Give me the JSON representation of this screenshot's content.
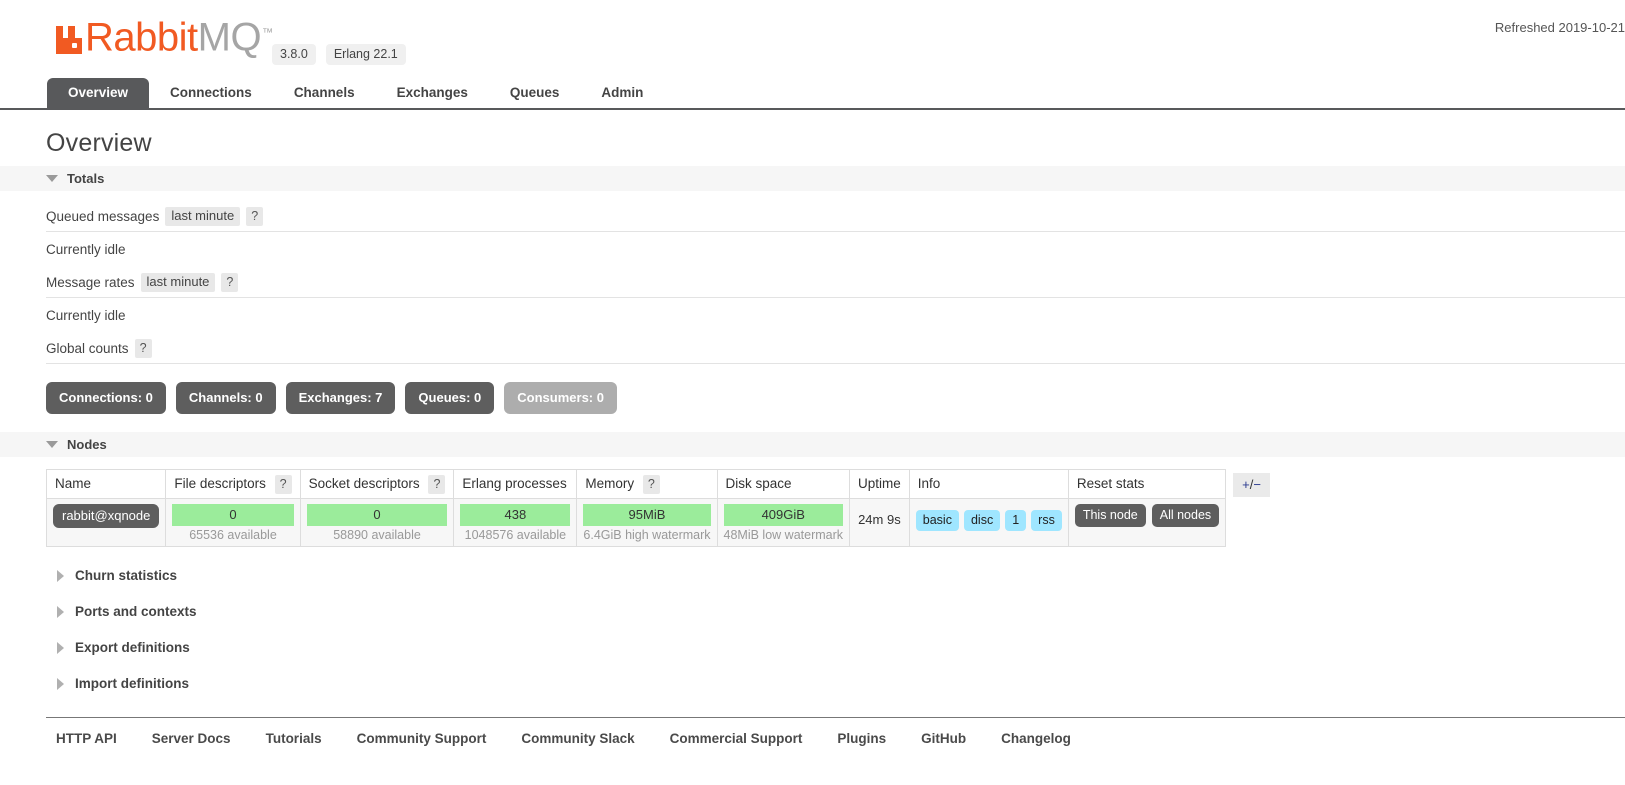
{
  "header": {
    "logo_rabbit": "Rabbit",
    "logo_mq": "MQ",
    "logo_tm": "™",
    "version": "3.8.0",
    "erlang": "Erlang 22.1",
    "refreshed": "Refreshed 2019-10-21"
  },
  "nav": {
    "tabs": [
      {
        "label": "Overview",
        "active": true
      },
      {
        "label": "Connections",
        "active": false
      },
      {
        "label": "Channels",
        "active": false
      },
      {
        "label": "Exchanges",
        "active": false
      },
      {
        "label": "Queues",
        "active": false
      },
      {
        "label": "Admin",
        "active": false
      }
    ]
  },
  "page": {
    "title": "Overview"
  },
  "totals": {
    "section_label": "Totals",
    "queued_messages_label": "Queued messages",
    "queued_messages_period": "last minute",
    "help": "?",
    "queued_messages_status": "Currently idle",
    "message_rates_label": "Message rates",
    "message_rates_period": "last minute",
    "message_rates_status": "Currently idle",
    "global_counts_label": "Global counts",
    "counts": [
      {
        "label": "Connections: 0",
        "muted": false
      },
      {
        "label": "Channels: 0",
        "muted": false
      },
      {
        "label": "Exchanges: 7",
        "muted": false
      },
      {
        "label": "Queues: 0",
        "muted": false
      },
      {
        "label": "Consumers: 0",
        "muted": true
      }
    ]
  },
  "nodes": {
    "section_label": "Nodes",
    "columns": [
      {
        "label": "Name",
        "help": false
      },
      {
        "label": "File descriptors",
        "help": true
      },
      {
        "label": "Socket descriptors",
        "help": true
      },
      {
        "label": "Erlang processes",
        "help": false
      },
      {
        "label": "Memory",
        "help": true
      },
      {
        "label": "Disk space",
        "help": false
      },
      {
        "label": "Uptime",
        "help": false
      },
      {
        "label": "Info",
        "help": false
      },
      {
        "label": "Reset stats",
        "help": false
      }
    ],
    "help": "?",
    "row": {
      "name": "rabbit@xqnode",
      "file_descriptors": "0",
      "file_descriptors_note": "65536 available",
      "socket_descriptors": "0",
      "socket_descriptors_note": "58890 available",
      "erlang_processes": "438",
      "erlang_processes_note": "1048576 available",
      "memory": "95MiB",
      "memory_note": "6.4GiB high watermark",
      "disk_space": "409GiB",
      "disk_space_note": "48MiB low watermark",
      "uptime": "24m 9s",
      "info_badges": [
        "basic",
        "disc",
        "1",
        "rss"
      ],
      "reset_buttons": [
        "This node",
        "All nodes"
      ]
    },
    "column_toggle": {
      "plus": "+",
      "slash": "/",
      "minus": "−"
    }
  },
  "collapsed_sections": [
    {
      "label": "Churn statistics"
    },
    {
      "label": "Ports and contexts"
    },
    {
      "label": "Export definitions"
    },
    {
      "label": "Import definitions"
    }
  ],
  "footer": {
    "links": [
      "HTTP API",
      "Server Docs",
      "Tutorials",
      "Community Support",
      "Community Slack",
      "Commercial Support",
      "Plugins",
      "GitHub",
      "Changelog"
    ]
  },
  "colors": {
    "brand_orange": "#f15a22",
    "dark_gray": "#58595b",
    "badge_gray": "#5e5e5e",
    "green_bar": "#9bec9b",
    "info_badge_blue": "#9fe6ff"
  }
}
